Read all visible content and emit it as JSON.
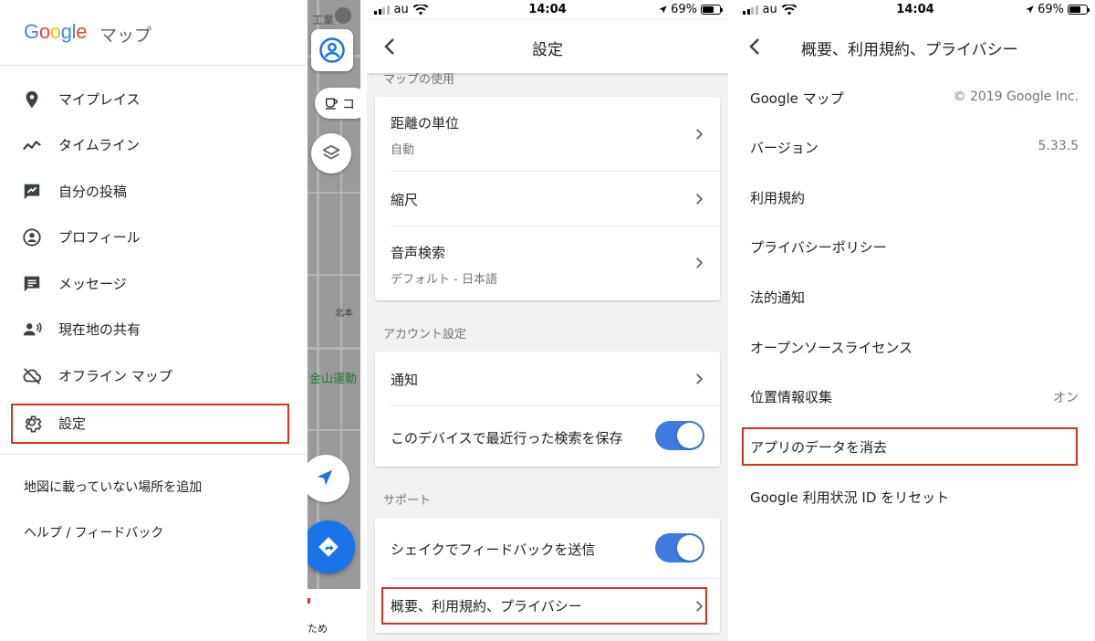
{
  "drawer": {
    "logo": {
      "G": "G",
      "o1": "o",
      "o2": "o",
      "g": "g",
      "l": "l",
      "e": "e"
    },
    "app_title": "マップ",
    "items": [
      {
        "label": "マイプレイス",
        "icon": "location-pin-icon"
      },
      {
        "label": "タイムライン",
        "icon": "timeline-icon"
      },
      {
        "label": "自分の投稿",
        "icon": "contributions-icon"
      },
      {
        "label": "プロフィール",
        "icon": "profile-icon"
      },
      {
        "label": "メッセージ",
        "icon": "message-icon"
      },
      {
        "label": "現在地の共有",
        "icon": "location-sharing-icon"
      },
      {
        "label": "オフライン マップ",
        "icon": "offline-cloud-icon"
      },
      {
        "label": "設定",
        "icon": "gear-icon"
      }
    ],
    "links": [
      "地図に載っていない場所を追加",
      "ヘルプ / フィードバック"
    ]
  },
  "map": {
    "texts": [
      "工業",
      "コ",
      "北本",
      "金山運動",
      "ため"
    ]
  },
  "status": {
    "carrier": "au",
    "time": "14:04",
    "battery": "69%",
    "battery_level": 0.69
  },
  "settings": {
    "title": "設定",
    "top_header": "マップの使用",
    "map_use": [
      {
        "label": "距離の単位",
        "sub": "自動"
      },
      {
        "label": "縮尺",
        "sub": ""
      },
      {
        "label": "音声検索",
        "sub": "デフォルト - 日本語"
      }
    ],
    "account_header": "アカウント設定",
    "account": [
      {
        "label": "通知"
      },
      {
        "label": "このデバイスで最近行った検索を保存",
        "toggle": true
      }
    ],
    "support_header": "サポート",
    "support": [
      {
        "label": "シェイクでフィードバックを送信",
        "toggle": true
      },
      {
        "label": "概要、利用規約、プライバシー"
      }
    ]
  },
  "about": {
    "title": "概要、利用規約、プライバシー",
    "rows": [
      {
        "label": "Google マップ",
        "value": "© 2019 Google Inc."
      },
      {
        "label": "バージョン",
        "value": "5.33.5"
      },
      {
        "label": "利用規約",
        "value": ""
      },
      {
        "label": "プライバシーポリシー",
        "value": ""
      },
      {
        "label": "法的通知",
        "value": ""
      },
      {
        "label": "オープンソースライセンス",
        "value": ""
      },
      {
        "label": "位置情報収集",
        "value": "オン"
      },
      {
        "label": "アプリのデータを消去",
        "value": ""
      },
      {
        "label": "Google 利用状況 ID をリセット",
        "value": ""
      }
    ]
  },
  "colors": {
    "highlight": "#d93025",
    "toggle_on": "#3f7ae0",
    "map_accent": "#1a73e8"
  }
}
